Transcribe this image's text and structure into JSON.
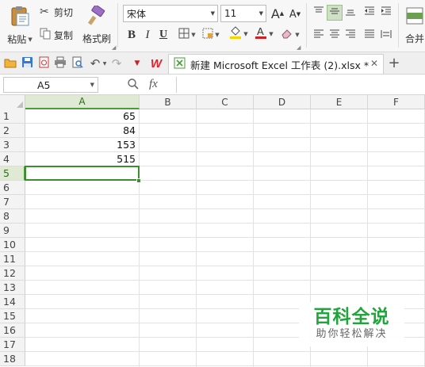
{
  "ribbon": {
    "paste_label": "粘贴",
    "cut_label": "剪切",
    "copy_label": "复制",
    "format_painter_label": "格式刷",
    "font_name": "宋体",
    "font_size": "11",
    "increase_font": "A",
    "decrease_font": "A",
    "bold": "B",
    "italic": "I",
    "underline": "U",
    "merge_label": "合并",
    "fill_color": "#f5d400",
    "font_color": "#d02020"
  },
  "quick_access": {
    "wps_logo": "W",
    "doc_title": "新建 Microsoft Excel 工作表 (2).xlsx *",
    "close_glyph": "✕",
    "new_tab_glyph": "+"
  },
  "formula_bar": {
    "name_box": "A5",
    "fx_label": "fx",
    "formula": ""
  },
  "grid": {
    "columns": [
      "A",
      "B",
      "C",
      "D",
      "E",
      "F"
    ],
    "active_column": "A",
    "rows": [
      "1",
      "2",
      "3",
      "4",
      "5",
      "6",
      "7",
      "8",
      "9",
      "10",
      "11",
      "12",
      "13",
      "14",
      "15",
      "16",
      "17",
      "18"
    ],
    "active_row": "5",
    "cells": {
      "A1": "65",
      "A2": "84",
      "A3": "153",
      "A4": "515"
    }
  },
  "watermark": {
    "title": "百科全说",
    "subtitle": "助你轻松解决"
  },
  "colors": {
    "accent": "#3b8e2e",
    "header_active_bg": "#dfe9d3",
    "wps_red": "#d7282f"
  }
}
